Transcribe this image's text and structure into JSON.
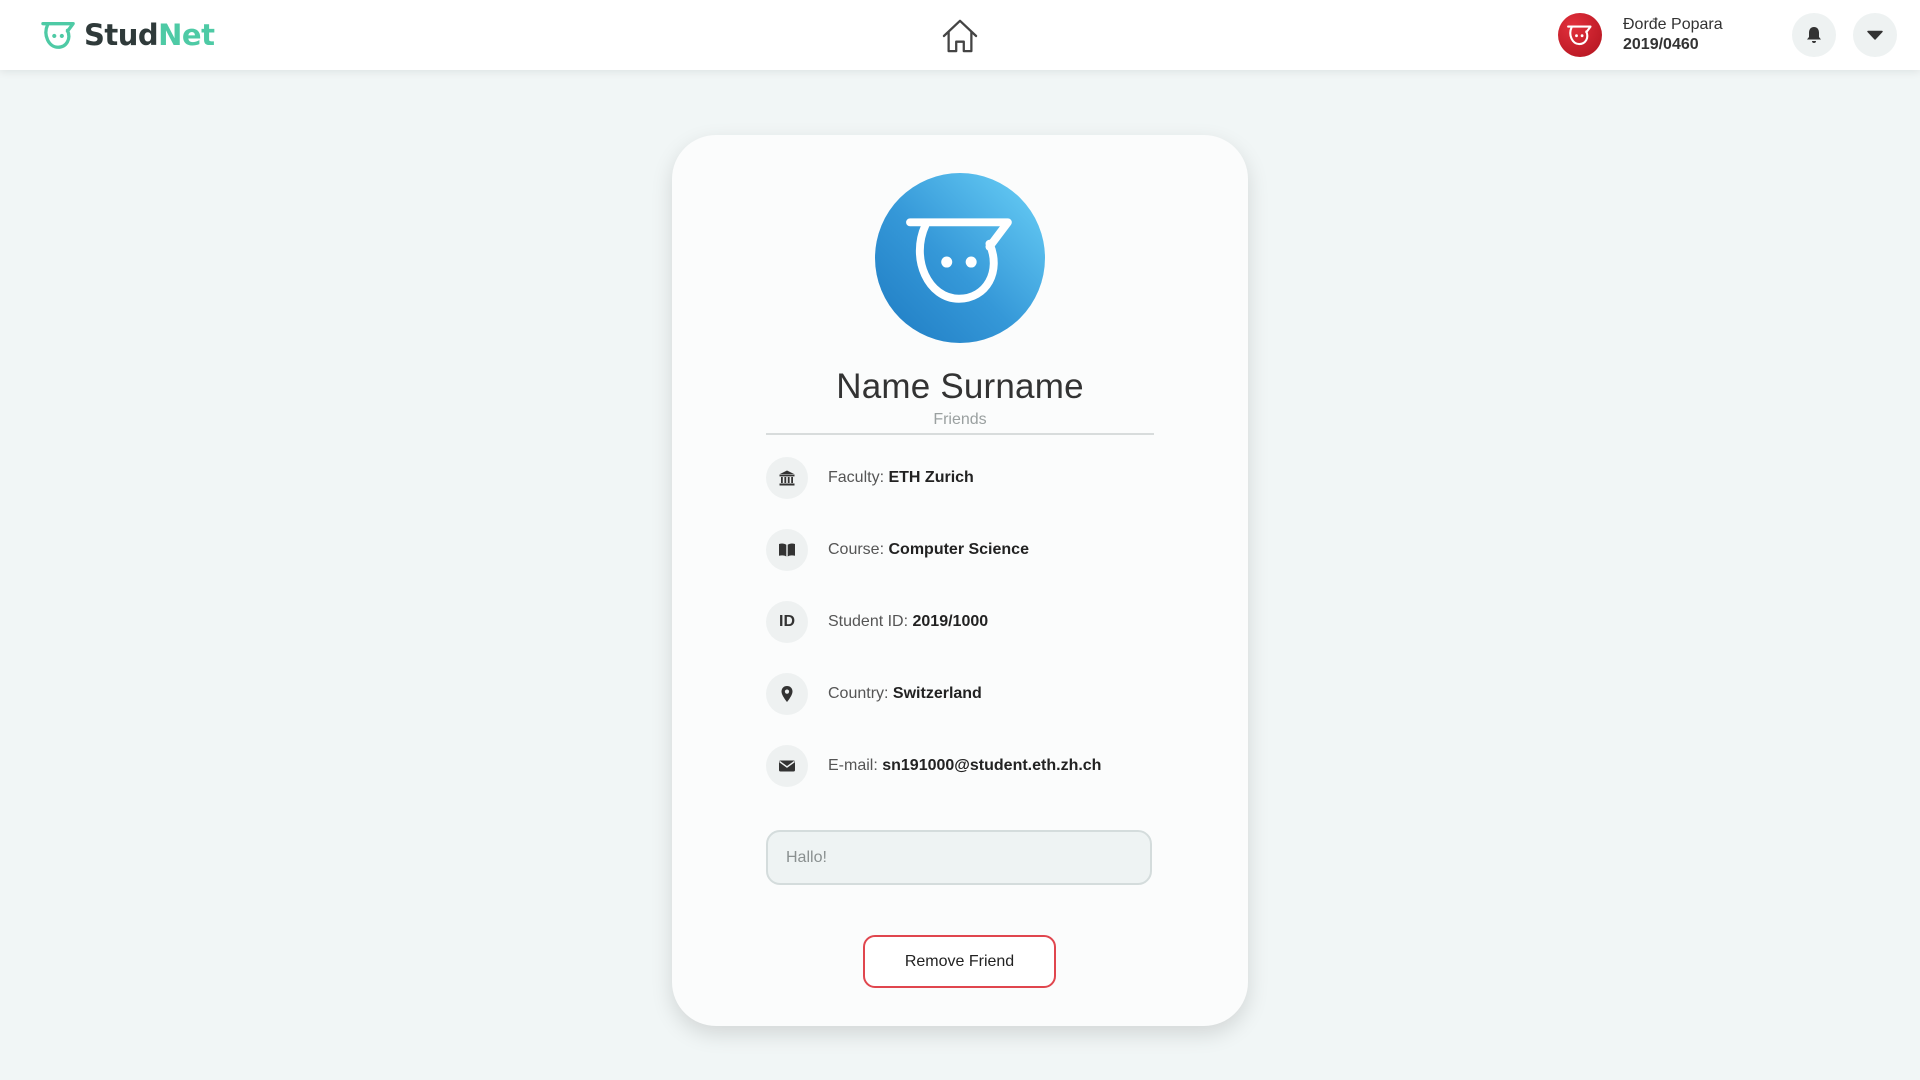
{
  "header": {
    "logo": {
      "part1": "Stud",
      "part2": "Net",
      "icon": "studnet-logo-icon"
    },
    "home_icon": "home-icon",
    "user": {
      "name": "Đorđe Popara",
      "id": "2019/0460",
      "avatar_icon": "user-avatar-icon"
    },
    "bell_icon": "bell-icon",
    "menu_icon": "caret-down-icon"
  },
  "profile": {
    "name": "Name Surname",
    "status": "Friends",
    "avatar_icon": "studnet-mascot-icon",
    "info": [
      {
        "icon": "bank-icon",
        "label": "Faculty:",
        "value": "ETH Zurich"
      },
      {
        "icon": "book-icon",
        "label": "Course:",
        "value": "Computer Science"
      },
      {
        "icon": "id-icon",
        "icon_text": "ID",
        "label": "Student ID:",
        "value": "2019/1000"
      },
      {
        "icon": "location-pin-icon",
        "label": "Country:",
        "value": "Switzerland"
      },
      {
        "icon": "envelope-icon",
        "label": "E-mail:",
        "value": "sn191000@student.eth.zh.ch"
      }
    ],
    "message": {
      "placeholder": "Hallo!",
      "value": ""
    },
    "action_button": "Remove Friend"
  },
  "colors": {
    "page_bg": "#f1f6f6",
    "brand_green": "#4ecaa5",
    "brand_dark": "#2f3a3a",
    "avatar_blue": "#2f8fd2",
    "user_avatar_red": "#c41a26",
    "danger_border": "#e0464e"
  }
}
